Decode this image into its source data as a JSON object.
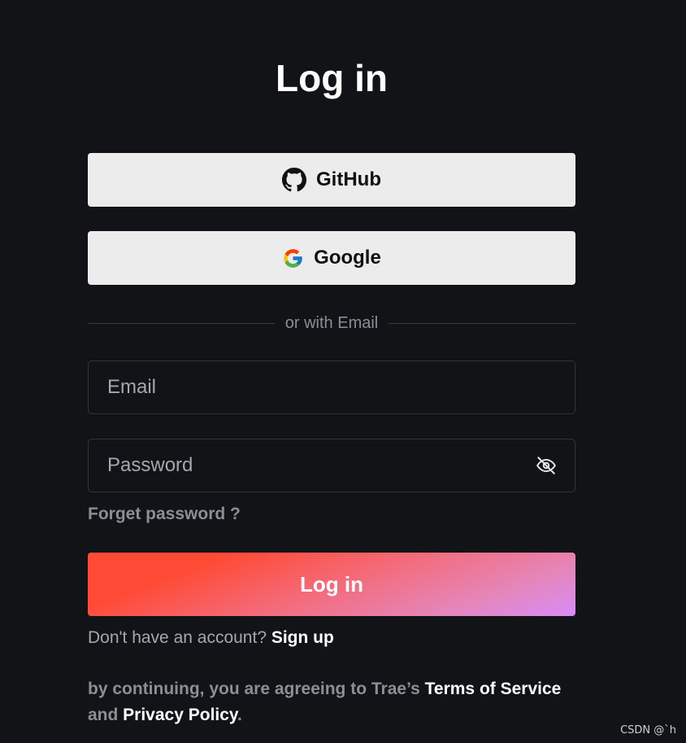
{
  "page": {
    "title": "Log in"
  },
  "oauth": {
    "github_label": "GitHub",
    "google_label": "Google"
  },
  "divider": {
    "text": "or with Email"
  },
  "form": {
    "email_placeholder": "Email",
    "password_placeholder": "Password",
    "forgot_password": "Forget password ?",
    "submit_label": "Log in"
  },
  "signup": {
    "prompt": "Don't have an account? ",
    "link": "Sign up"
  },
  "terms": {
    "prefix": "by continuing, you are agreeing to Trae’s ",
    "terms_link": "Terms of Service",
    "middle": " and ",
    "privacy_link": "Privacy Policy",
    "suffix": "."
  },
  "watermark": {
    "text": "CSDN @`h"
  },
  "icons": {
    "github": "github-icon",
    "google": "google-icon",
    "password_toggle": "eye-off-icon"
  },
  "colors": {
    "background": "#121317",
    "oauth_button_bg": "#ececec",
    "muted_text": "#8d8e94",
    "gradient_start": "#ff4a35",
    "gradient_end": "#d88cf7"
  }
}
